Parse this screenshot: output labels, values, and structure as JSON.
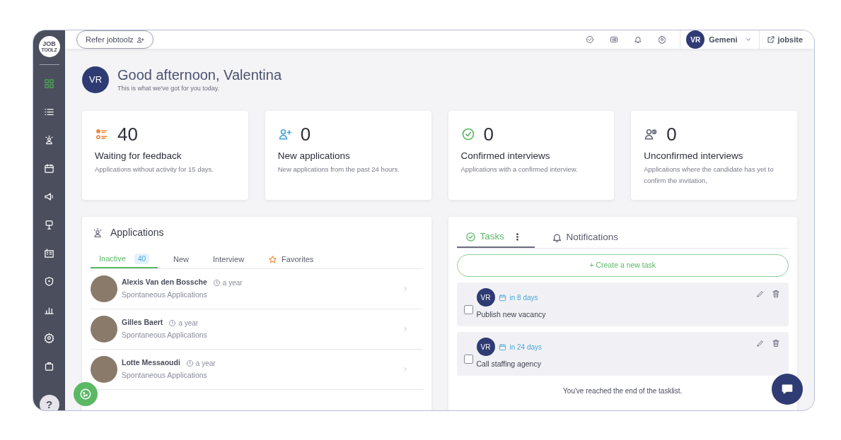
{
  "logo": {
    "line1": "JOB",
    "line2": "TOOLZ"
  },
  "sidebar": {
    "items": [
      {
        "kind": "grid",
        "selected": true
      },
      {
        "kind": "list",
        "selected": false
      },
      {
        "kind": "person",
        "selected": false
      },
      {
        "kind": "calendar",
        "selected": false
      },
      {
        "kind": "megaphone",
        "selected": false
      },
      {
        "kind": "sign",
        "selected": false
      },
      {
        "kind": "building",
        "selected": false
      },
      {
        "kind": "shield",
        "selected": false
      },
      {
        "kind": "chart",
        "selected": false
      },
      {
        "kind": "gear",
        "selected": false
      },
      {
        "kind": "bag",
        "selected": false
      }
    ],
    "help": "?"
  },
  "topbar": {
    "refer_button": "Refer jobtoolz",
    "icons": [
      {
        "kind": "check"
      },
      {
        "kind": "card"
      },
      {
        "kind": "bell"
      },
      {
        "kind": "gear"
      }
    ],
    "user": {
      "initials": "VR",
      "name": "Gemeni"
    },
    "jobsite": "jobsite"
  },
  "greeting": {
    "initials": "VR",
    "title": "Good afternoon, Valentina",
    "subtitle": "This is what we've got for you today."
  },
  "stats": [
    {
      "kind": "feedback",
      "value": "40",
      "title": "Waiting for feedback",
      "description": "Applications without activity for 15 days."
    },
    {
      "kind": "new",
      "value": "0",
      "title": "New applications",
      "description": "New applications from the past 24 hours."
    },
    {
      "kind": "confirmed",
      "value": "0",
      "title": "Confirmed interviews",
      "description": "Applications with a confirmed interview."
    },
    {
      "kind": "unconfirmed",
      "value": "0",
      "title": "Unconfirmed interviews",
      "description": "Applications where the candidate has yet to confirm the invitation,"
    }
  ],
  "applications": {
    "title": "Applications",
    "tabs": [
      {
        "label": "Inactive",
        "count": "40",
        "selected": true
      },
      {
        "label": "New",
        "selected": false
      },
      {
        "label": "Interview",
        "selected": false
      },
      {
        "label": "Favorites",
        "star": true,
        "selected": false
      }
    ],
    "rows": [
      {
        "name": "Alexis Van den Bossche",
        "time": "a year",
        "source": "Spontaneous Applications"
      },
      {
        "name": "Gilles Baert",
        "time": "a year",
        "source": "Spontaneous Applications"
      },
      {
        "name": "Lotte Messaoudi",
        "time": "a year",
        "source": "Spontaneous Applications"
      }
    ]
  },
  "tasks_panel": {
    "tabs": [
      {
        "label": "Tasks",
        "kind": "tasks",
        "selected": true
      },
      {
        "label": "Notifications",
        "kind": "notifications",
        "selected": false
      }
    ],
    "create_button": "+ Create a new task",
    "tasks": [
      {
        "initials": "VR",
        "due": "in 8 days",
        "title": "Publish new vacancy",
        "checked": false
      },
      {
        "initials": "VR",
        "due": "in 24 days",
        "title": "Call staffing agency",
        "checked": false
      }
    ],
    "end_note": "You've reached the end of the tasklist."
  }
}
